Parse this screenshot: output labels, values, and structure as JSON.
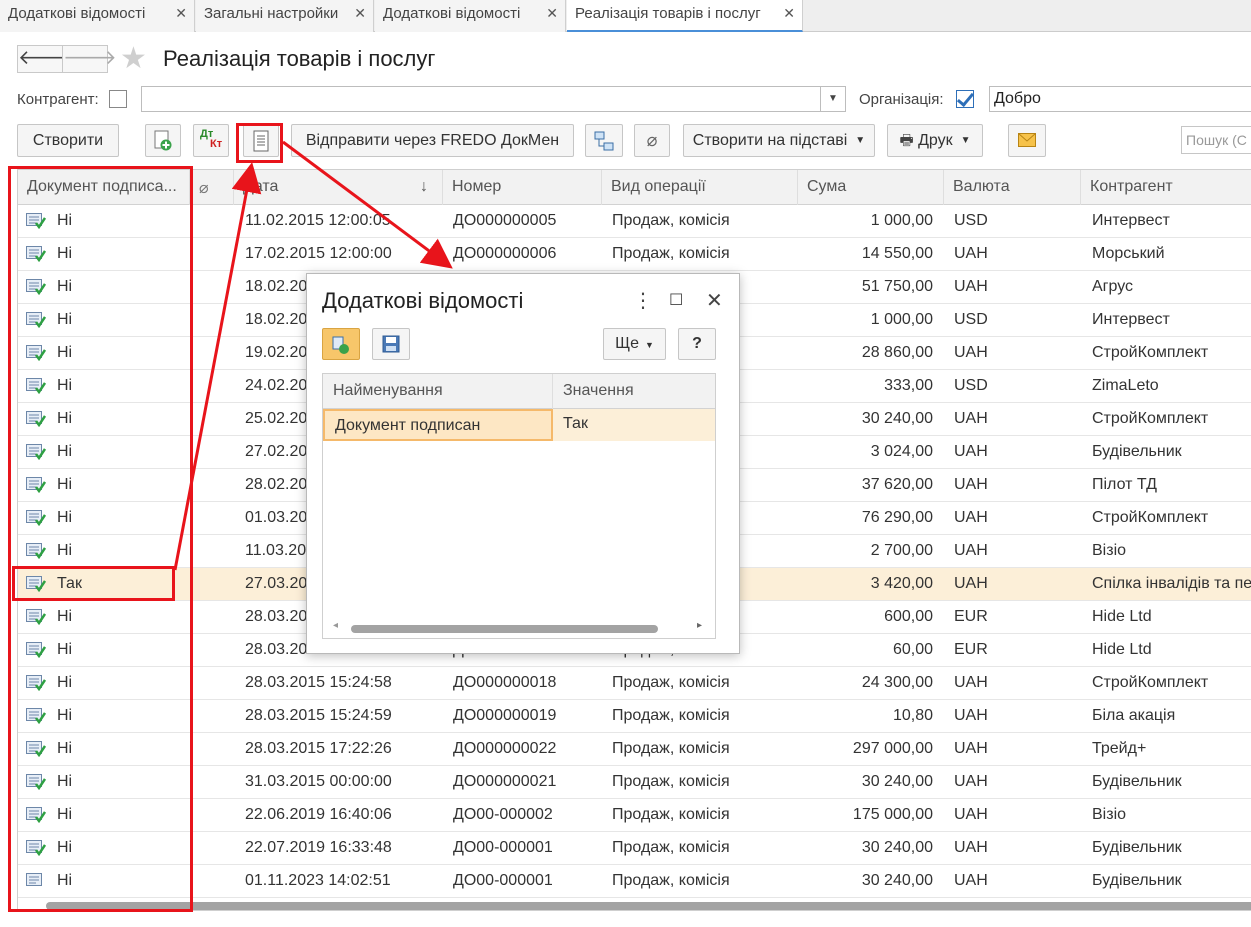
{
  "tabs": [
    {
      "label": "Додаткові відомості",
      "close": "✕"
    },
    {
      "label": "Загальні настройки",
      "close": "✕"
    },
    {
      "label": "Додаткові відомості",
      "close": "✕"
    },
    {
      "label": "Реалізація товарів і послуг",
      "close": "✕"
    }
  ],
  "header": {
    "title": "Реалізація товарів і послуг",
    "back": "🡐",
    "forward": "🡒",
    "star": "★"
  },
  "filters": {
    "kontragent_label": "Контрагент:",
    "kontragent_value": "",
    "organization_label": "Організація:",
    "organization_value": "Добро",
    "organization_checked": true
  },
  "toolbar": {
    "create": "Створити",
    "send_fredo": "Відправити через FREDO ДокМен",
    "create_based": "Створити на підставі",
    "print": "Друк",
    "search_placeholder": "Пошук (C",
    "dtkt": "Дт",
    "dtkt2": "Кт"
  },
  "table": {
    "columns": [
      "Документ подписа...",
      "",
      "Дата",
      "Номер",
      "Вид операції",
      "Сума",
      "Валюта",
      "Контрагент"
    ],
    "sort_indicator": "↓",
    "rows": [
      {
        "signed": "Ні",
        "date": "11.02.2015 12:00:05",
        "number": "ДО000000005",
        "op": "Продаж, комісія",
        "sum": "1 000,00",
        "cur": "USD",
        "kontr": "Интервест"
      },
      {
        "signed": "Ні",
        "date": "17.02.2015 12:00:00",
        "number": "ДО000000006",
        "op": "Продаж, комісія",
        "sum": "14 550,00",
        "cur": "UAH",
        "kontr": "Морський"
      },
      {
        "signed": "Ні",
        "date": "18.02.20",
        "number": "",
        "op": "",
        "sum": "51 750,00",
        "cur": "UAH",
        "kontr": "Агрус"
      },
      {
        "signed": "Ні",
        "date": "18.02.20",
        "number": "",
        "op": "",
        "sum": "1 000,00",
        "cur": "USD",
        "kontr": "Интервест"
      },
      {
        "signed": "Ні",
        "date": "19.02.20",
        "number": "",
        "op": "",
        "sum": "28 860,00",
        "cur": "UAH",
        "kontr": "СтройКомплект"
      },
      {
        "signed": "Ні",
        "date": "24.02.20",
        "number": "",
        "op": "",
        "sum": "333,00",
        "cur": "USD",
        "kontr": "ZimaLeto"
      },
      {
        "signed": "Ні",
        "date": "25.02.20",
        "number": "",
        "op": "",
        "sum": "30 240,00",
        "cur": "UAH",
        "kontr": "СтройКомплект"
      },
      {
        "signed": "Ні",
        "date": "27.02.20",
        "number": "",
        "op": "",
        "sum": "3 024,00",
        "cur": "UAH",
        "kontr": "Будівельник"
      },
      {
        "signed": "Ні",
        "date": "28.02.20",
        "number": "",
        "op": "",
        "sum": "37 620,00",
        "cur": "UAH",
        "kontr": "Пілот ТД"
      },
      {
        "signed": "Ні",
        "date": "01.03.20",
        "number": "",
        "op": "",
        "sum": "76 290,00",
        "cur": "UAH",
        "kontr": "СтройКомплект"
      },
      {
        "signed": "Ні",
        "date": "11.03.20",
        "number": "",
        "op": "",
        "sum": "2 700,00",
        "cur": "UAH",
        "kontr": "Візіо"
      },
      {
        "signed": "Так",
        "date": "27.03.20",
        "number": "",
        "op": "",
        "sum": "3 420,00",
        "cur": "UAH",
        "kontr": "Спілка інвалідів та пе..."
      },
      {
        "signed": "Ні",
        "date": "28.03.20",
        "number": "",
        "op": "",
        "sum": "600,00",
        "cur": "EUR",
        "kontr": "Hide Ltd"
      },
      {
        "signed": "Ні",
        "date": "28.03.2015 15:24:57",
        "number": "ДО000000017",
        "op": "Продаж, комісія",
        "sum": "60,00",
        "cur": "EUR",
        "kontr": "Hide Ltd"
      },
      {
        "signed": "Ні",
        "date": "28.03.2015 15:24:58",
        "number": "ДО000000018",
        "op": "Продаж, комісія",
        "sum": "24 300,00",
        "cur": "UAH",
        "kontr": "СтройКомплект"
      },
      {
        "signed": "Ні",
        "date": "28.03.2015 15:24:59",
        "number": "ДО000000019",
        "op": "Продаж, комісія",
        "sum": "10,80",
        "cur": "UAH",
        "kontr": "Біла акація"
      },
      {
        "signed": "Ні",
        "date": "28.03.2015 17:22:26",
        "number": "ДО000000022",
        "op": "Продаж, комісія",
        "sum": "297 000,00",
        "cur": "UAH",
        "kontr": "Трейд+"
      },
      {
        "signed": "Ні",
        "date": "31.03.2015 00:00:00",
        "number": "ДО000000021",
        "op": "Продаж, комісія",
        "sum": "30 240,00",
        "cur": "UAH",
        "kontr": "Будівельник"
      },
      {
        "signed": "Ні",
        "date": "22.06.2019 16:40:06",
        "number": "ДО00-000002",
        "op": "Продаж, комісія",
        "sum": "175 000,00",
        "cur": "UAH",
        "kontr": "Візіо"
      },
      {
        "signed": "Ні",
        "date": "22.07.2019 16:33:48",
        "number": "ДО00-000001",
        "op": "Продаж, комісія",
        "sum": "30 240,00",
        "cur": "UAH",
        "kontr": "Будівельник"
      },
      {
        "signed": "Ні",
        "date": "01.11.2023 14:02:51",
        "number": "ДО00-000001",
        "op": "Продаж, комісія",
        "sum": "30 240,00",
        "cur": "UAH",
        "kontr": "Будівельник"
      }
    ]
  },
  "dialog": {
    "title": "Додаткові відомості",
    "more": "Ще",
    "help": "?",
    "menu_icon": "⋮",
    "maximize_icon": "☐",
    "close_icon": "✕",
    "columns": [
      "Найменування",
      "Значення"
    ],
    "row": {
      "name": "Документ подписан",
      "value": "Так"
    },
    "scroll_left": "◂",
    "scroll_right": "▸"
  },
  "colors": {
    "annotation": "#e8141b",
    "selected_row": "#fcefd8",
    "accent": "#4a8fd8"
  }
}
